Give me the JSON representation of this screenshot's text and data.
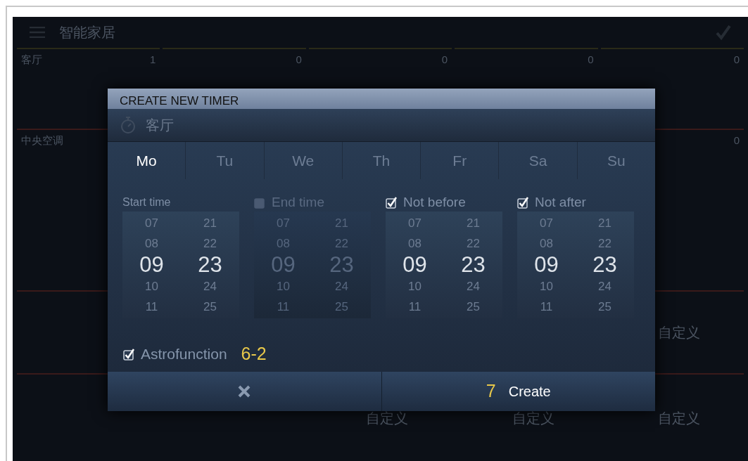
{
  "app": {
    "title": "智能家居",
    "rows": [
      [
        {
          "label": "客厅",
          "count": "1"
        },
        {
          "count": "0"
        },
        {
          "count": "0"
        },
        {
          "count": "0"
        },
        {
          "count": "0"
        }
      ],
      [
        {
          "label": "中央空调"
        },
        {},
        {},
        {},
        {
          "count": "0"
        }
      ],
      [
        {},
        {},
        {},
        {},
        {
          "text": "自定义"
        }
      ],
      [
        {},
        {},
        {
          "text": "自定义"
        },
        {
          "text": "自定义"
        },
        {
          "text": "自定义"
        }
      ]
    ]
  },
  "dialog": {
    "title": "CREATE NEW TIMER",
    "room": "客厅",
    "days": [
      {
        "label": "Mo",
        "selected": true
      },
      {
        "label": "Tu",
        "selected": false
      },
      {
        "label": "We",
        "selected": false
      },
      {
        "label": "Th",
        "selected": false
      },
      {
        "label": "Fr",
        "selected": false
      },
      {
        "label": "Sa",
        "selected": false
      },
      {
        "label": "Su",
        "selected": false
      }
    ],
    "pickers": [
      {
        "label": "Start time",
        "kind": "plain",
        "hours": [
          {
            "text": "07",
            "selected": false
          },
          {
            "text": "08",
            "selected": false
          },
          {
            "text": "09",
            "selected": true
          },
          {
            "text": "10",
            "selected": false
          },
          {
            "text": "11",
            "selected": false
          }
        ],
        "minutes": [
          {
            "text": "21",
            "selected": false
          },
          {
            "text": "22",
            "selected": false
          },
          {
            "text": "23",
            "selected": true
          },
          {
            "text": "24",
            "selected": false
          },
          {
            "text": "25",
            "selected": false
          }
        ]
      },
      {
        "label": "End time",
        "kind": "checkbox",
        "checked": false,
        "hours": [
          {
            "text": "07",
            "selected": false
          },
          {
            "text": "08",
            "selected": false
          },
          {
            "text": "09",
            "selected": true
          },
          {
            "text": "10",
            "selected": false
          },
          {
            "text": "11",
            "selected": false
          }
        ],
        "minutes": [
          {
            "text": "21",
            "selected": false
          },
          {
            "text": "22",
            "selected": false
          },
          {
            "text": "23",
            "selected": true
          },
          {
            "text": "24",
            "selected": false
          },
          {
            "text": "25",
            "selected": false
          }
        ]
      },
      {
        "label": "Not before",
        "kind": "checkbox",
        "checked": true,
        "hours": [
          {
            "text": "07",
            "selected": false
          },
          {
            "text": "08",
            "selected": false
          },
          {
            "text": "09",
            "selected": true
          },
          {
            "text": "10",
            "selected": false
          },
          {
            "text": "11",
            "selected": false
          }
        ],
        "minutes": [
          {
            "text": "21",
            "selected": false
          },
          {
            "text": "22",
            "selected": false
          },
          {
            "text": "23",
            "selected": true
          },
          {
            "text": "24",
            "selected": false
          },
          {
            "text": "25",
            "selected": false
          }
        ]
      },
      {
        "label": "Not after",
        "kind": "checkbox",
        "checked": true,
        "hours": [
          {
            "text": "07",
            "selected": false
          },
          {
            "text": "08",
            "selected": false
          },
          {
            "text": "09",
            "selected": true
          },
          {
            "text": "10",
            "selected": false
          },
          {
            "text": "11",
            "selected": false
          }
        ],
        "minutes": [
          {
            "text": "21",
            "selected": false
          },
          {
            "text": "22",
            "selected": false
          },
          {
            "text": "23",
            "selected": true
          },
          {
            "text": "24",
            "selected": false
          },
          {
            "text": "25",
            "selected": false
          }
        ]
      }
    ],
    "astro": {
      "label": "Astrofunction",
      "checked": true,
      "callout": "6-2"
    },
    "create": {
      "label": "Create",
      "callout": "7"
    }
  }
}
